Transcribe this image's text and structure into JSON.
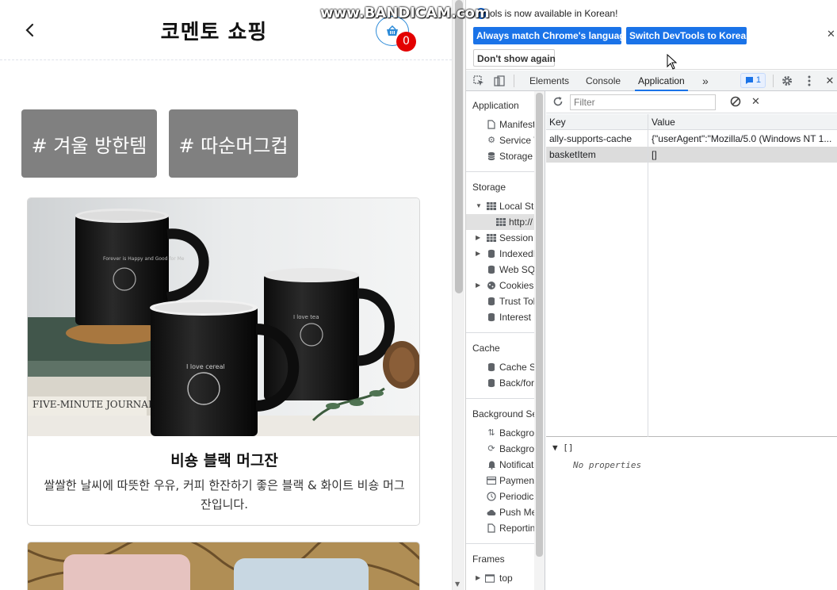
{
  "shop": {
    "title": "코멘토 쇼핑",
    "cart_count": "0",
    "tags": [
      "# 겨울 방한템",
      "# 따순머그컵"
    ],
    "products": [
      {
        "name": "비숑 블랙 머그잔",
        "description": "쌀쌀한 날씨에 따뜻한 우유, 커피 한잔하기 좋은 블랙 & 화이트 비숑 머그잔입니다.",
        "mug_labels": [
          "Forever is Happy and Good for Me",
          "I love tea",
          "I love cereal"
        ],
        "book_label": "FIVE-MINUTE JOURNAL"
      }
    ]
  },
  "watermark": "www.BANDICAM.com",
  "devtools": {
    "infobar": {
      "message": "DevTools is now available in Korean!",
      "message_visible": "ols is now available in Korean!",
      "buttons": [
        "Always match Chrome's language",
        "Switch DevTools to Korean",
        "Don't show again"
      ]
    },
    "tabs": [
      "Elements",
      "Console",
      "Application"
    ],
    "active_tab": "Application",
    "more_tabs": "»",
    "issues_count": "1",
    "sidebar": {
      "application_header": "Application",
      "application_items": [
        "Manifest",
        "Service Workers",
        "Storage"
      ],
      "storage_header": "Storage",
      "storage_items": [
        "Local Storage",
        "http://",
        "Session Storage",
        "IndexedDB",
        "Web SQL",
        "Cookies",
        "Trust Tokens",
        "Interest Groups"
      ],
      "cache_header": "Cache",
      "cache_items": [
        "Cache Storage",
        "Back/forward cache"
      ],
      "background_header": "Background Services",
      "background_items": [
        "Background Fetch",
        "Background Sync",
        "Notifications",
        "Payment Handler",
        "Periodic Background Sync",
        "Push Messaging",
        "Reporting API"
      ],
      "frames_header": "Frames",
      "frames_items": [
        "top"
      ]
    },
    "filter_placeholder": "Filter",
    "table": {
      "headers": [
        "Key",
        "Value"
      ],
      "rows": [
        {
          "key": "ally-supports-cache",
          "value": "{\"userAgent\":\"Mozilla/5.0 (Windows NT 1..."
        },
        {
          "key": "basketItem",
          "value": "[]"
        }
      ]
    },
    "preview": {
      "root": "▼ []",
      "empty": "No properties"
    }
  },
  "colors": {
    "tag_bg": "#808080",
    "cart_badge": "#e30000",
    "cart_border": "#2b8ad8",
    "devtools_accent": "#1a73e8"
  }
}
